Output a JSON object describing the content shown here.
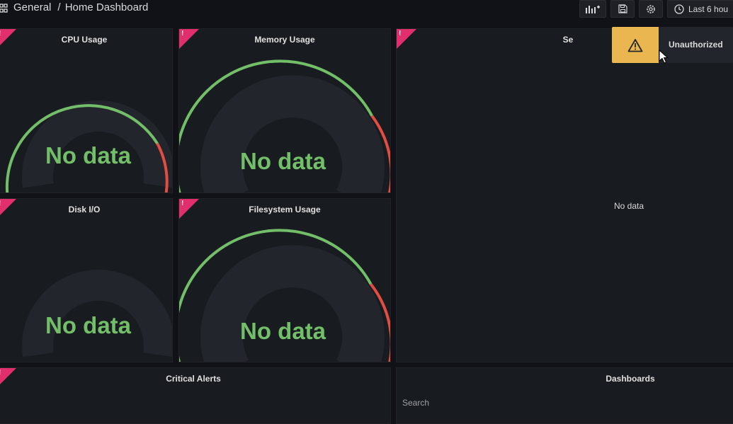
{
  "header": {
    "folder": "General",
    "separator": "/",
    "dashboard_title": "Home Dashboard",
    "time_range_label": "Last 6 hou",
    "icons": [
      "grid-icon",
      "add-panel-icon",
      "save-icon",
      "settings-icon",
      "clock-icon"
    ]
  },
  "panels": {
    "cpu": {
      "title": "CPU Usage",
      "value": "No data"
    },
    "memory": {
      "title": "Memory Usage",
      "value": "No data"
    },
    "sessions": {
      "title": "Se",
      "value": "No data"
    },
    "disk": {
      "title": "Disk I/O",
      "value": "No data"
    },
    "filesystem": {
      "title": "Filesystem Usage",
      "value": "No data"
    },
    "alerts": {
      "title": "Critical Alerts"
    },
    "dashboards": {
      "title": "Dashboards",
      "search": "Search"
    }
  },
  "panel_error_mark": "!",
  "toast": {
    "message": "Unauthorized",
    "icon": "warning-icon"
  },
  "colors": {
    "background": "#111217",
    "panel": "#181b1f",
    "ok_green": "#73bf69",
    "threshold_red": "#e24d42",
    "error_corner": "#e02f6c",
    "warning_yellow": "#e9b64f"
  }
}
